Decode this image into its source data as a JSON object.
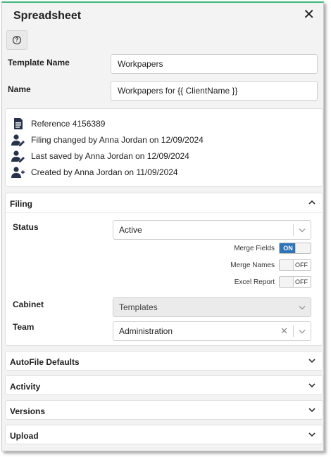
{
  "window": {
    "title": "Spreadsheet",
    "close_label": "✕"
  },
  "help": {
    "label": "?"
  },
  "fields": {
    "template_name_label": "Template Name",
    "template_name_value": "Workpapers",
    "name_label": "Name",
    "name_value": "Workpapers for {{ ClientName }}"
  },
  "info": [
    {
      "icon": "document-icon",
      "text": "Reference 4156389"
    },
    {
      "icon": "user-edit-icon",
      "text": "Filing changed by Anna Jordan on 12/09/2024"
    },
    {
      "icon": "user-edit-icon",
      "text": "Last saved by Anna Jordan on 12/09/2024"
    },
    {
      "icon": "user-add-icon",
      "text": "Created by Anna Jordan on 11/09/2024"
    }
  ],
  "filing": {
    "title": "Filing",
    "status_label": "Status",
    "status_value": "Active",
    "merge_fields_label": "Merge Fields",
    "merge_fields_state": "ON",
    "merge_names_label": "Merge Names",
    "merge_names_state": "OFF",
    "excel_report_label": "Excel Report",
    "excel_report_state": "OFF",
    "cabinet_label": "Cabinet",
    "cabinet_value": "Templates",
    "team_label": "Team",
    "team_value": "Administration",
    "clear_label": "✕"
  },
  "sections": {
    "autofile": "AutoFile Defaults",
    "activity": "Activity",
    "versions": "Versions",
    "upload": "Upload"
  },
  "colors": {
    "accent": "#3db77a",
    "toggle_on": "#2e74b8"
  }
}
